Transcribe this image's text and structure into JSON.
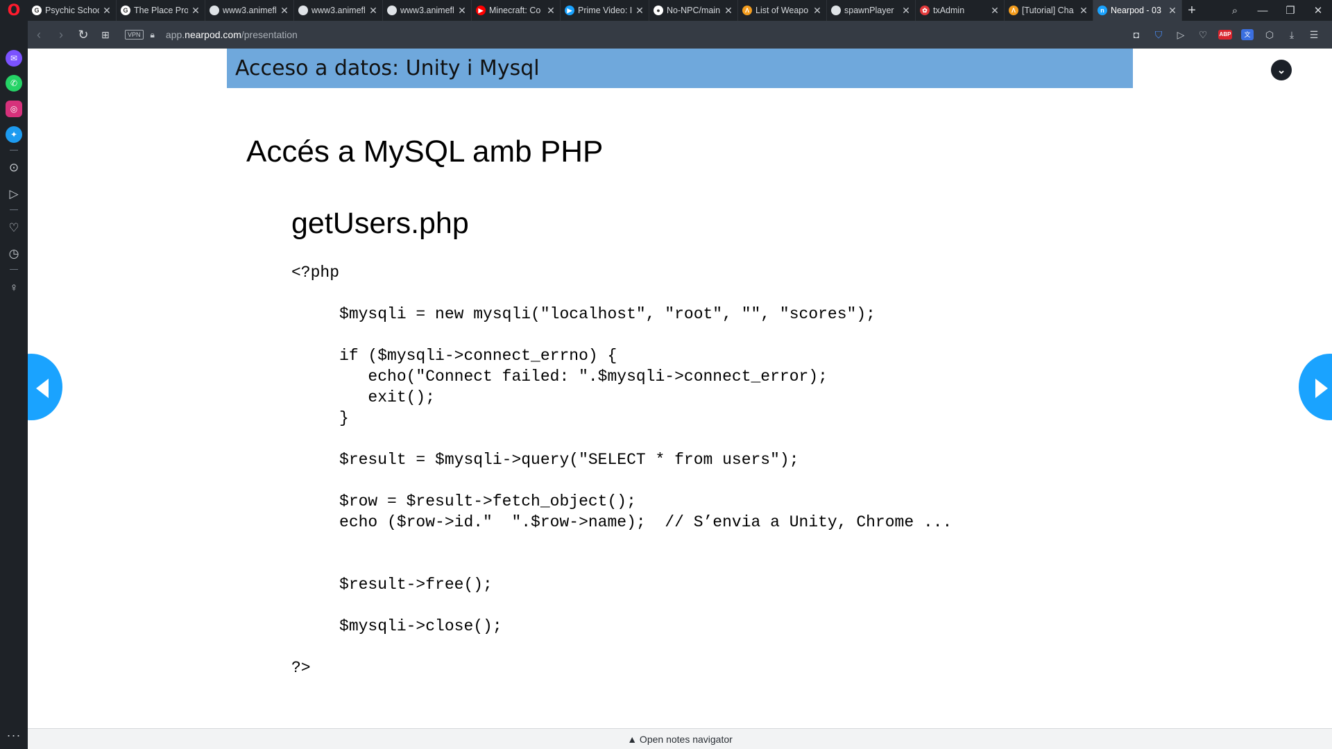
{
  "browser": {
    "tabs": [
      {
        "title": "Psychic School",
        "favicon_color": "#ffffff",
        "favicon_glyph": "G",
        "active": false
      },
      {
        "title": "The Place Pro",
        "favicon_color": "#ffffff",
        "favicon_glyph": "G",
        "active": false
      },
      {
        "title": "www3.animefl",
        "favicon_color": "#dfe3e7",
        "favicon_glyph": "",
        "active": false
      },
      {
        "title": "www3.animefl",
        "favicon_color": "#dfe3e7",
        "favicon_glyph": "",
        "active": false
      },
      {
        "title": "www3.animefl",
        "favicon_color": "#dfe3e7",
        "favicon_glyph": "",
        "active": false
      },
      {
        "title": "Minecraft: Co",
        "favicon_color": "#ff0000",
        "favicon_glyph": "▶",
        "active": false
      },
      {
        "title": "Prime Video: I",
        "favicon_color": "#1aa3ff",
        "favicon_glyph": "▶",
        "active": false
      },
      {
        "title": "No-NPC/main",
        "favicon_color": "#ffffff",
        "favicon_glyph": "●",
        "active": false
      },
      {
        "title": "List of Weapo",
        "favicon_color": "#f49d1e",
        "favicon_glyph": "Λ",
        "active": false
      },
      {
        "title": "spawnPlayer",
        "favicon_color": "#dfe3e7",
        "favicon_glyph": "",
        "active": false
      },
      {
        "title": "txAdmin",
        "favicon_color": "#e3393b",
        "favicon_glyph": "✿",
        "active": false
      },
      {
        "title": "[Tutorial] Cha",
        "favicon_color": "#f49d1e",
        "favicon_glyph": "Λ",
        "active": false
      },
      {
        "title": "Nearpod - 03",
        "favicon_color": "#1aa3ff",
        "favicon_glyph": "n",
        "active": true
      }
    ],
    "new_tab_label": "+",
    "url_prefix": "app.",
    "url_domain": "nearpod.com",
    "url_path": "/presentation",
    "vpn_label": "VPN",
    "abp_label": "ABP"
  },
  "slide": {
    "header": "Acceso a datos: Unity i Mysql",
    "title": "Accés a MySQL amb PHP",
    "file_title": "getUsers.php",
    "code_lines": [
      "<?php",
      "     $mysqli = new mysqli(\"localhost\", \"root\", \"\", \"scores\");",
      "     if ($mysqli->connect_errno) {",
      "        echo(\"Connect failed: \".$mysqli->connect_error);",
      "        exit();",
      "     }",
      "     $result = $mysqli->query(\"SELECT * from users\");",
      "     $row = $result->fetch_object();",
      "     echo ($row->id.\"  \".$row->name);  // S’envia a Unity, Chrome ...",
      "     $result->free();",
      "     $mysqli->close();",
      "?>"
    ]
  },
  "notes_navigator": {
    "label": "▲ Open notes navigator"
  },
  "colors": {
    "header_bg": "#6fa8dc",
    "nav_arrow": "#1aa3ff",
    "browser_dark": "#1e2227"
  }
}
